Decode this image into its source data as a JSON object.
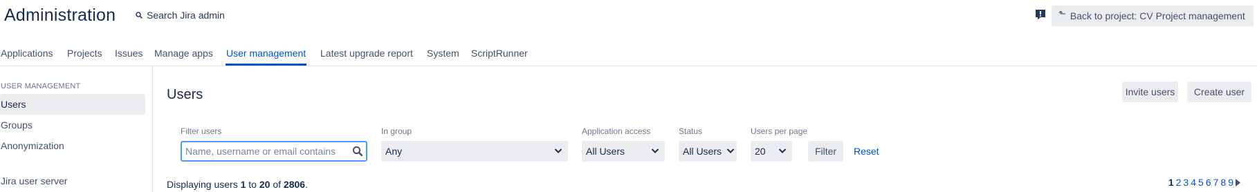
{
  "header": {
    "title": "Administration",
    "search_label": "Search Jira admin",
    "back_button": "Back to project: CV Project management"
  },
  "nav": {
    "tabs": [
      {
        "label": "Applications"
      },
      {
        "label": "Projects"
      },
      {
        "label": "Issues"
      },
      {
        "label": "Manage apps"
      },
      {
        "label": "User management",
        "active": true
      },
      {
        "label": "Latest upgrade report"
      },
      {
        "label": "System"
      },
      {
        "label": "ScriptRunner"
      }
    ]
  },
  "sidebar": {
    "heading": "USER MANAGEMENT",
    "items": [
      {
        "label": "Users",
        "active": true
      },
      {
        "label": "Groups"
      },
      {
        "label": "Anonymization"
      },
      {
        "label": "Jira user server"
      }
    ]
  },
  "main": {
    "title": "Users",
    "invite_button": "Invite users",
    "create_button": "Create user"
  },
  "filters": {
    "filter_users_label": "Filter users",
    "filter_users_placeholder": "Name, username or email contains",
    "in_group_label": "In group",
    "in_group_value": "Any",
    "app_access_label": "Application access",
    "app_access_value": "All Users",
    "status_label": "Status",
    "status_value": "All Users",
    "per_page_label": "Users per page",
    "per_page_value": "20",
    "filter_button": "Filter",
    "reset_link": "Reset"
  },
  "results": {
    "prefix": "Displaying users",
    "from": "1",
    "to_word": "to",
    "to": "20",
    "of_word": "of",
    "total": "2806",
    "suffix": "."
  },
  "pagination": {
    "current": "1",
    "pages": [
      "2",
      "3",
      "4",
      "5",
      "6",
      "7",
      "8",
      "9"
    ],
    "next_icon": "caret-right-icon"
  },
  "colors": {
    "accent": "#0052cc",
    "text": "#172b4d",
    "button_bg": "#ebecf0",
    "focus_border": "#4c9aff"
  },
  "icons": [
    "search-icon",
    "feedback-icon",
    "back-arrow-icon",
    "chevron-down-icon",
    "magnifier-icon",
    "caret-right-icon"
  ]
}
